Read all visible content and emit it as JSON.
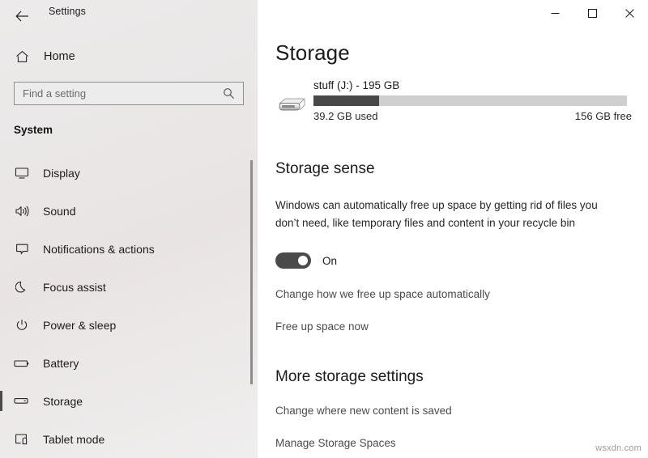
{
  "window": {
    "app_title": "Settings",
    "back_icon": "back-arrow-icon",
    "minimize_label": "—",
    "maximize_label": "□",
    "close_label": "✕"
  },
  "sidebar": {
    "home": {
      "label": "Home",
      "icon": "home-icon"
    },
    "search": {
      "placeholder": "Find a setting",
      "value": "",
      "icon": "search-icon"
    },
    "group_title": "System",
    "items": [
      {
        "label": "Display",
        "icon": "monitor-icon",
        "selected": false
      },
      {
        "label": "Sound",
        "icon": "speaker-icon",
        "selected": false
      },
      {
        "label": "Notifications & actions",
        "icon": "chat-bubble-icon",
        "selected": false
      },
      {
        "label": "Focus assist",
        "icon": "moon-icon",
        "selected": false
      },
      {
        "label": "Power & sleep",
        "icon": "power-icon",
        "selected": false
      },
      {
        "label": "Battery",
        "icon": "battery-icon",
        "selected": false
      },
      {
        "label": "Storage",
        "icon": "drive-icon",
        "selected": true
      },
      {
        "label": "Tablet mode",
        "icon": "tablet-icon",
        "selected": false
      }
    ]
  },
  "main": {
    "page_title": "Storage",
    "drive": {
      "icon": "external-drive-icon",
      "name": "stuff (J:) - 195 GB",
      "used_label": "39.2 GB used",
      "free_label": "156 GB free",
      "used_percent": 21,
      "used_gb": 39.2,
      "free_gb": 156,
      "total_gb": 195,
      "bar_used_color": "#484848",
      "bar_track_color": "#cfcfcf"
    },
    "storage_sense": {
      "heading": "Storage sense",
      "description": "Windows can automatically free up space by getting rid of files you don’t need, like temporary files and content in your recycle bin",
      "toggle_state": "On",
      "toggle_on": true,
      "links": [
        "Change how we free up space automatically",
        "Free up space now"
      ]
    },
    "more_storage": {
      "heading": "More storage settings",
      "links": [
        "Change where new content is saved",
        "Manage Storage Spaces"
      ]
    }
  },
  "watermark": "wsxdn.com",
  "colors": {
    "accent_selection": "#4a4a4a",
    "sidebar_bg": "#eae7e6",
    "content_bg": "#ffffff",
    "text_primary": "#1b1b1b",
    "link_text": "#4c4c4c"
  }
}
